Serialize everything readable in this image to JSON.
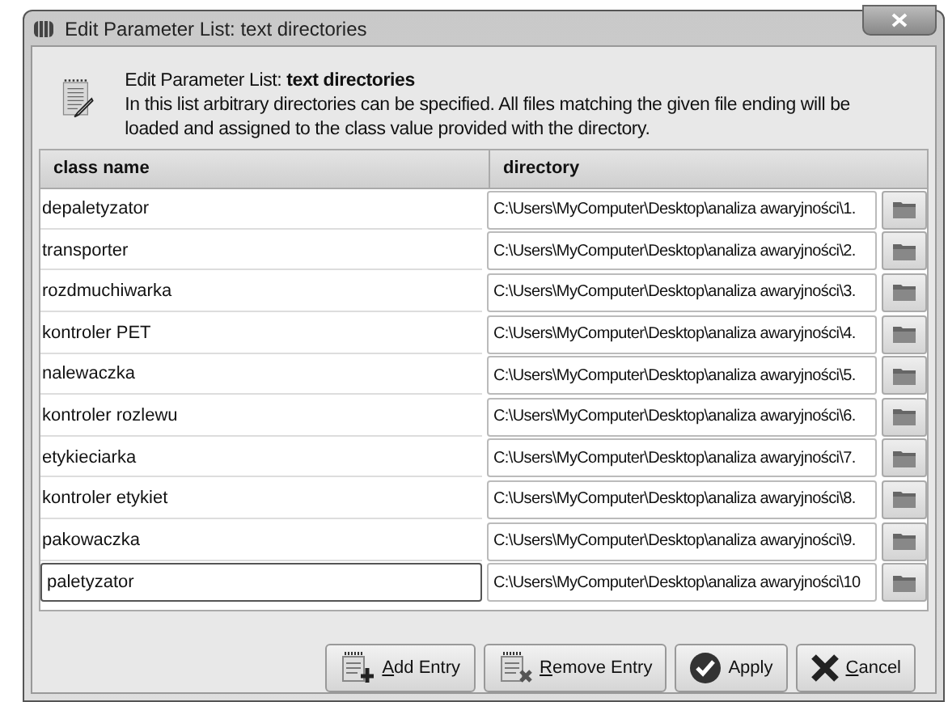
{
  "window": {
    "title": "Edit Parameter List: text directories"
  },
  "header": {
    "title": "Edit Parameter List: **text directories**",
    "description": "In this list arbitrary directories can be specified. All files matching the given file ending will be loaded and assigned to the class value provided with the directory."
  },
  "table": {
    "columns": [
      "class name",
      "directory"
    ],
    "rows": [
      {
        "class_name": "depaletyzator",
        "directory": "C:\\Users\\MyComputer\\Desktop\\analiza awaryjności\\1.",
        "editing": false
      },
      {
        "class_name": "transporter",
        "directory": "C:\\Users\\MyComputer\\Desktop\\analiza awaryjności\\2.",
        "editing": false
      },
      {
        "class_name": "rozdmuchiwarka",
        "directory": "C:\\Users\\MyComputer\\Desktop\\analiza awaryjności\\3.",
        "editing": false
      },
      {
        "class_name": "kontroler PET",
        "directory": "C:\\Users\\MyComputer\\Desktop\\analiza awaryjności\\4.",
        "editing": false
      },
      {
        "class_name": "nalewaczka",
        "directory": "C:\\Users\\MyComputer\\Desktop\\analiza awaryjności\\5.",
        "editing": false
      },
      {
        "class_name": "kontroler rozlewu",
        "directory": "C:\\Users\\MyComputer\\Desktop\\analiza awaryjności\\6.",
        "editing": false
      },
      {
        "class_name": "etykieciarka",
        "directory": "C:\\Users\\MyComputer\\Desktop\\analiza awaryjności\\7.",
        "editing": false
      },
      {
        "class_name": "kontroler etykiet",
        "directory": "C:\\Users\\MyComputer\\Desktop\\analiza awaryjności\\8.",
        "editing": false
      },
      {
        "class_name": "pakowaczka",
        "directory": "C:\\Users\\MyComputer\\Desktop\\analiza awaryjności\\9.",
        "editing": false
      },
      {
        "class_name": "paletyzator",
        "directory": "C:\\Users\\MyComputer\\Desktop\\analiza awaryjności\\10",
        "editing": true
      }
    ]
  },
  "buttons": [
    {
      "kind": "add",
      "label": "Add Entry",
      "mnemonic": true
    },
    {
      "kind": "remove",
      "label": "Remove Entry",
      "mnemonic": true
    },
    {
      "kind": "apply",
      "label": "Apply",
      "mnemonic": false
    },
    {
      "kind": "cancel",
      "label": "Cancel",
      "mnemonic": true
    }
  ]
}
